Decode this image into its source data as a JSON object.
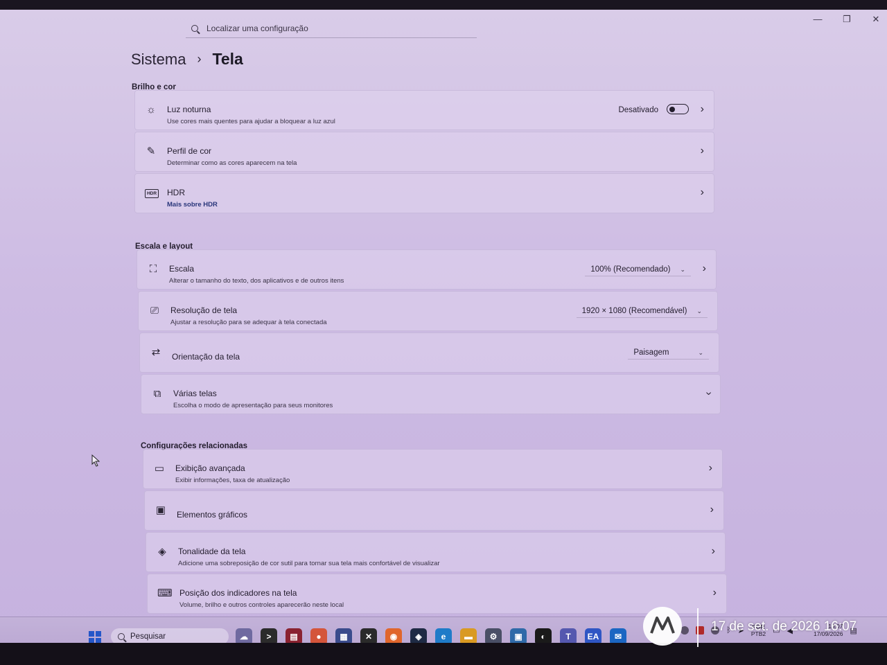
{
  "window": {
    "minimize_glyph": "—",
    "restore_glyph": "❐",
    "close_glyph": "✕"
  },
  "search": {
    "placeholder": "Localizar uma configuração",
    "icon": "search-icon"
  },
  "breadcrumb": {
    "parent": "Sistema",
    "separator": "›",
    "current": "Tela"
  },
  "sections": {
    "brightness": "Brilho e cor",
    "scale_layout": "Escala e layout",
    "related": "Configurações relacionadas"
  },
  "night_light": {
    "icon": "sun-icon",
    "title": "Luz noturna",
    "subtitle": "Use cores mais quentes para ajudar a bloquear a luz azul",
    "state": "Desativado",
    "enabled": false
  },
  "color_profile": {
    "icon": "pen-icon",
    "title": "Perfil de cor",
    "subtitle": "Determinar como as cores aparecem na tela"
  },
  "hdr": {
    "icon": "hdr-icon",
    "icon_text": "HDR",
    "title": "HDR",
    "link": "Mais sobre HDR"
  },
  "scale": {
    "icon": "scale-icon",
    "title": "Escala",
    "subtitle": "Alterar o tamanho do texto, dos aplicativos e de outros itens",
    "value": "100% (Recomendado)"
  },
  "resolution": {
    "icon": "resolution-icon",
    "title": "Resolução de tela",
    "subtitle": "Ajustar a resolução para se adequar à tela conectada",
    "value": "1920 × 1080 (Recomendável)"
  },
  "orientation": {
    "icon": "orientation-icon",
    "title": "Orientação da tela",
    "value": "Paisagem"
  },
  "multiple_displays": {
    "icon": "multiple-displays-icon",
    "title": "Várias telas",
    "subtitle": "Escolha o modo de apresentação para seus monitores"
  },
  "advanced_display": {
    "icon": "monitor-icon",
    "title": "Exibição avançada",
    "subtitle": "Exibir informações, taxa de atualização"
  },
  "graphics": {
    "icon": "graphics-card-icon",
    "title": "Elementos gráficos"
  },
  "color_tint": {
    "icon": "layers-icon",
    "title": "Tonalidade da tela",
    "subtitle": "Adicione uma sobreposição de cor sutil para tornar sua tela mais confortável de visualizar"
  },
  "indicator_position": {
    "icon": "indicator-icon",
    "title": "Posição dos indicadores na tela",
    "subtitle": "Volume, brilho e outros controles aparecerão neste local"
  },
  "taskbar": {
    "search_label": "Pesquisar",
    "apps": [
      {
        "name": "widgets-app",
        "color": "#6f6aa0",
        "glyph": "☁"
      },
      {
        "name": "terminal-app",
        "color": "#2b2b2b",
        "glyph": ">"
      },
      {
        "name": "winrar-app",
        "color": "#8a2230",
        "glyph": "▤"
      },
      {
        "name": "chrome-app",
        "color": "#d4553b",
        "glyph": "●"
      },
      {
        "name": "store-app",
        "color": "#3a4b8c",
        "glyph": "▦"
      },
      {
        "name": "xbox-app",
        "color": "#2a2a2a",
        "glyph": "✕"
      },
      {
        "name": "firefox-app",
        "color": "#e0662c",
        "glyph": "◉"
      },
      {
        "name": "steam-app",
        "color": "#1e2a44",
        "glyph": "◈"
      },
      {
        "name": "edge-app",
        "color": "#1f7bc8",
        "glyph": "e"
      },
      {
        "name": "explorer-app",
        "color": "#d99a23",
        "glyph": "▬"
      },
      {
        "name": "settings-app",
        "color": "#4a4f66",
        "glyph": "⚙"
      },
      {
        "name": "remote-desktop-app",
        "color": "#2f6aa8",
        "glyph": "▣"
      },
      {
        "name": "github-app",
        "color": "#1a1a1a",
        "glyph": "◐"
      },
      {
        "name": "teams-app",
        "color": "#5558af",
        "glyph": "T"
      },
      {
        "name": "ea-app",
        "color": "#2f56c4",
        "glyph": "EA"
      },
      {
        "name": "outlook-app",
        "color": "#1b66c2",
        "glyph": "✉"
      }
    ],
    "tray": {
      "lang_top": "POR",
      "lang_bottom": "PTB2",
      "time": "16:07",
      "date": "17/09/2026"
    }
  },
  "watermark": {
    "text": "17 de set. de 2026 16:07"
  }
}
